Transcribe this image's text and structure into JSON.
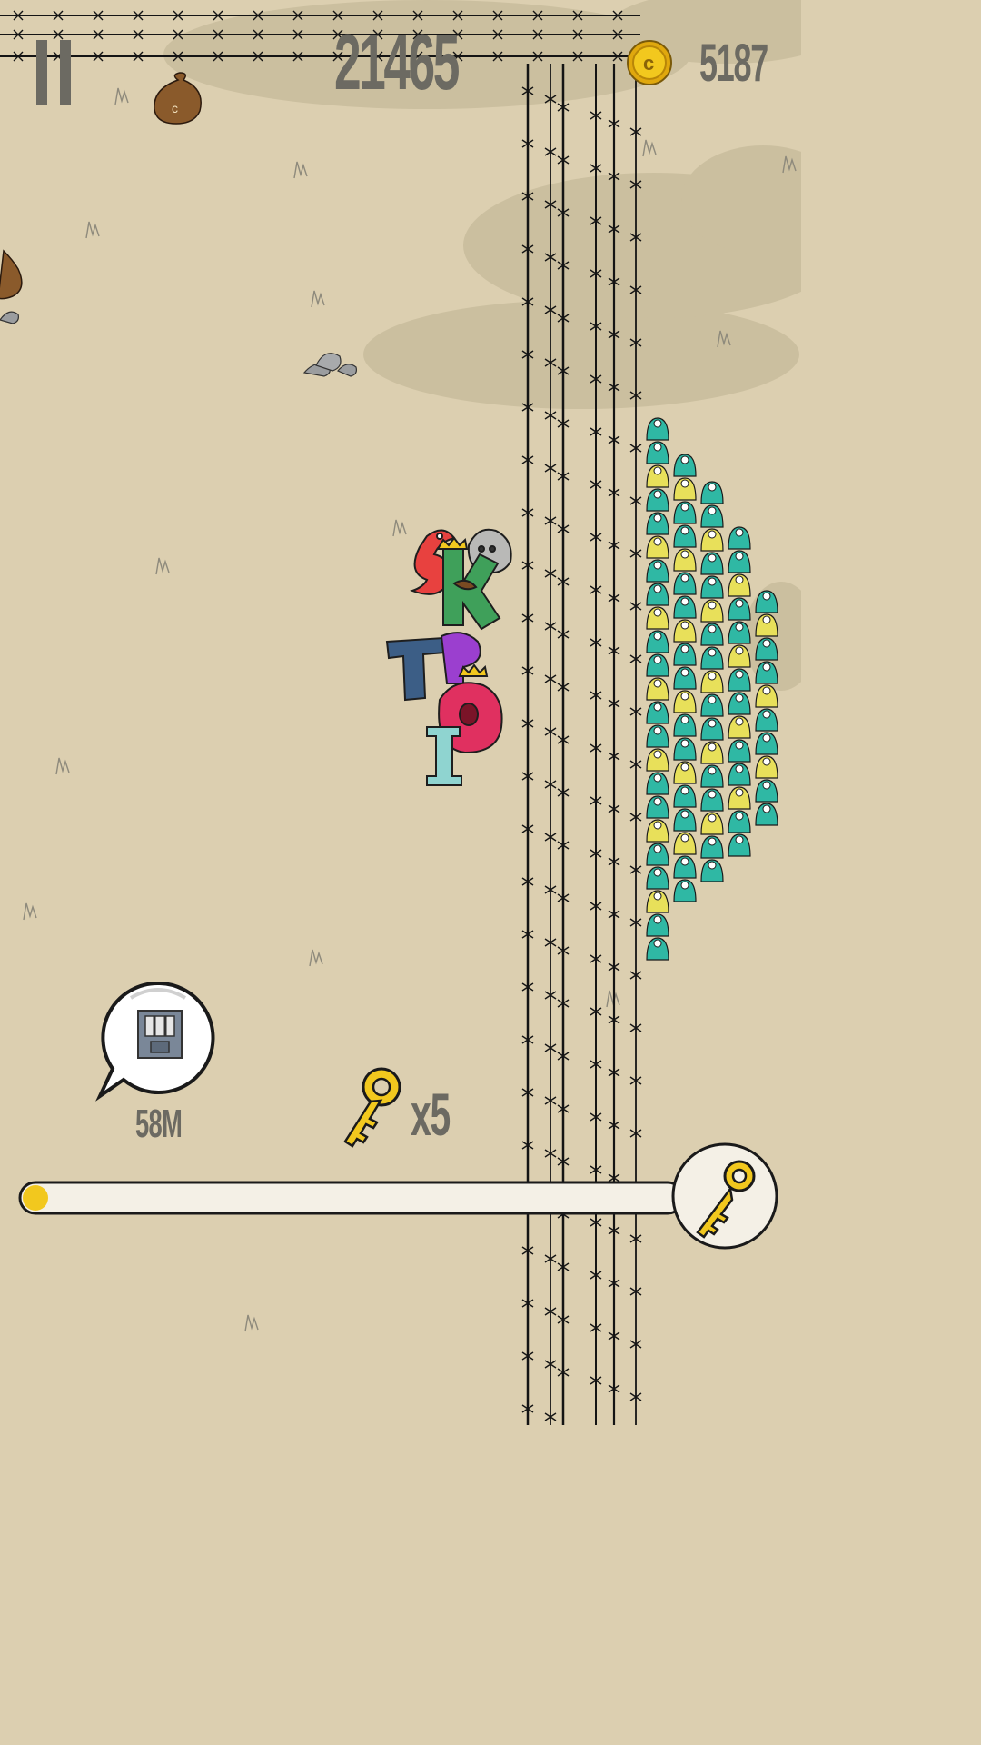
{
  "hud": {
    "score": "21465",
    "coin_count": "5187",
    "pause_icon": "pause-icon",
    "coin_icon": "coin-icon"
  },
  "objective": {
    "icon": "door-icon",
    "distance": "58M"
  },
  "keys": {
    "icon": "key-icon",
    "count": "x5"
  },
  "key_progress": {
    "fraction": 0.03,
    "icon": "key-icon"
  },
  "colors": {
    "background": "#dccfb0",
    "shadow_patch": "#cbbf9f",
    "hud_text": "#6c6a62",
    "gold": "#f2c81e",
    "money_bag": "#8a5a2b"
  }
}
